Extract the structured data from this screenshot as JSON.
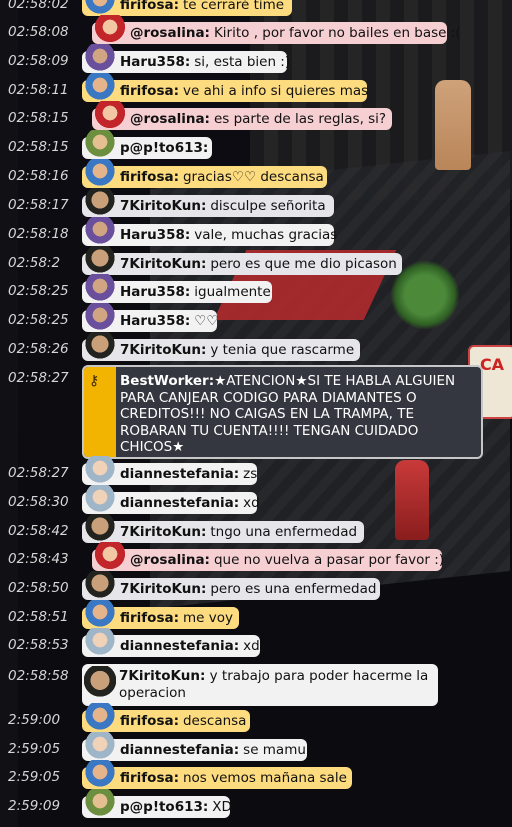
{
  "chat": {
    "top_message": {
      "time": "02:58:02",
      "name": "firifosa:",
      "text": "te cerraré time"
    },
    "messages": [
      {
        "time": "02:58:08",
        "name": "@rosalina:",
        "text": "Kirito , por favor no bailes en base :(",
        "style": "pink",
        "avatar": "rosalina-avatar"
      },
      {
        "time": "02:58:09",
        "name": "Haru358:",
        "text": "si, esta bien :)",
        "style": "white",
        "avatar": "haru-avatar"
      },
      {
        "time": "02:58:11",
        "name": "firifosa:",
        "text": "ve ahi a info si quieres mas",
        "style": "yellow",
        "avatar": "firifosa-avatar"
      },
      {
        "time": "02:58:15",
        "name": "@rosalina:",
        "text": "es parte de las reglas, si?",
        "style": "pink",
        "avatar": "rosalina-avatar"
      },
      {
        "time": "02:58:15",
        "name": "p@p!to613:",
        "text": ".",
        "style": "white",
        "avatar": "papito-avatar"
      },
      {
        "time": "02:58:16",
        "name": "firifosa:",
        "text": "gracias♡♡ descansa",
        "style": "yellow",
        "avatar": "firifosa-avatar"
      },
      {
        "time": "02:58:17",
        "name": "7KiritoKun:",
        "text": "disculpe señorita",
        "style": "gray",
        "avatar": "kirito-avatar"
      },
      {
        "time": "02:58:18",
        "name": "Haru358:",
        "text": "vale, muchas gracias",
        "style": "white",
        "avatar": "haru-avatar"
      },
      {
        "time": "02:58:2",
        "name": "7KiritoKun:",
        "text": "pero es que me dio picason",
        "style": "gray",
        "avatar": "kirito-avatar"
      },
      {
        "time": "02:58:25",
        "name": "Haru358:",
        "text": "igualmente",
        "style": "white",
        "avatar": "haru-avatar"
      },
      {
        "time": "02:58:25",
        "name": "Haru358:",
        "text": "♡♡",
        "style": "white",
        "avatar": "haru-avatar"
      },
      {
        "time": "02:58:26",
        "name": "7KiritoKun:",
        "text": "y tenia que rascarme",
        "style": "gray",
        "avatar": "kirito-avatar"
      }
    ],
    "announcement": {
      "time": "02:58:27",
      "name": "BestWorker:",
      "text": "★ATENCION★SI TE HABLA ALGUIEN PARA CANJEAR CODIGO PARA DIAMANTES O CREDITOS!!! NO CAIGAS EN LA TRAMPA, TE ROBARAN TU CUENTA!!!! TENGAN CUIDADO CHICOS★"
    },
    "messages2": [
      {
        "time": "02:58:27",
        "name": "diannestefania:",
        "text": "zs",
        "style": "white",
        "avatar": "dianne-avatar"
      },
      {
        "time": "02:58:30",
        "name": "diannestefania:",
        "text": "xd",
        "style": "white",
        "avatar": "dianne-avatar"
      },
      {
        "time": "02:58:42",
        "name": "7KiritoKun:",
        "text": "tngo una enfermedad",
        "style": "gray",
        "avatar": "kirito-avatar"
      },
      {
        "time": "02:58:43",
        "name": "@rosalina:",
        "text": "que no vuelva a pasar por favor :)",
        "style": "pink",
        "avatar": "rosalina-avatar"
      },
      {
        "time": "02:58:50",
        "name": "7KiritoKun:",
        "text": "pero es una enfermedad",
        "style": "gray",
        "avatar": "kirito-avatar"
      },
      {
        "time": "02:58:51",
        "name": "firifosa:",
        "text": "me voy",
        "style": "yellow",
        "avatar": "firifosa-avatar"
      },
      {
        "time": "02:58:53",
        "name": "diannestefania:",
        "text": "xd",
        "style": "white",
        "avatar": "dianne-avatar"
      }
    ],
    "long_message": {
      "time": "02:58:58",
      "name": "7KiritoKun:",
      "text": "y trabajo para poder hacerme la operacion"
    },
    "messages3": [
      {
        "time": "2:59:00",
        "name": "firifosa:",
        "text": "descansa",
        "style": "yellow",
        "avatar": "firifosa-avatar"
      },
      {
        "time": "2:59:05",
        "name": "diannestefania:",
        "text": "se mamu",
        "style": "white",
        "avatar": "dianne-avatar"
      },
      {
        "time": "2:59:05",
        "name": "firifosa:",
        "text": "nos vemos mañana sale",
        "style": "yellow",
        "avatar": "firifosa-avatar"
      },
      {
        "time": "2:59:09",
        "name": "p@p!to613:",
        "text": "XD",
        "style": "white",
        "avatar": "papito-avatar"
      }
    ]
  },
  "room": {
    "sign_text": "CA"
  }
}
